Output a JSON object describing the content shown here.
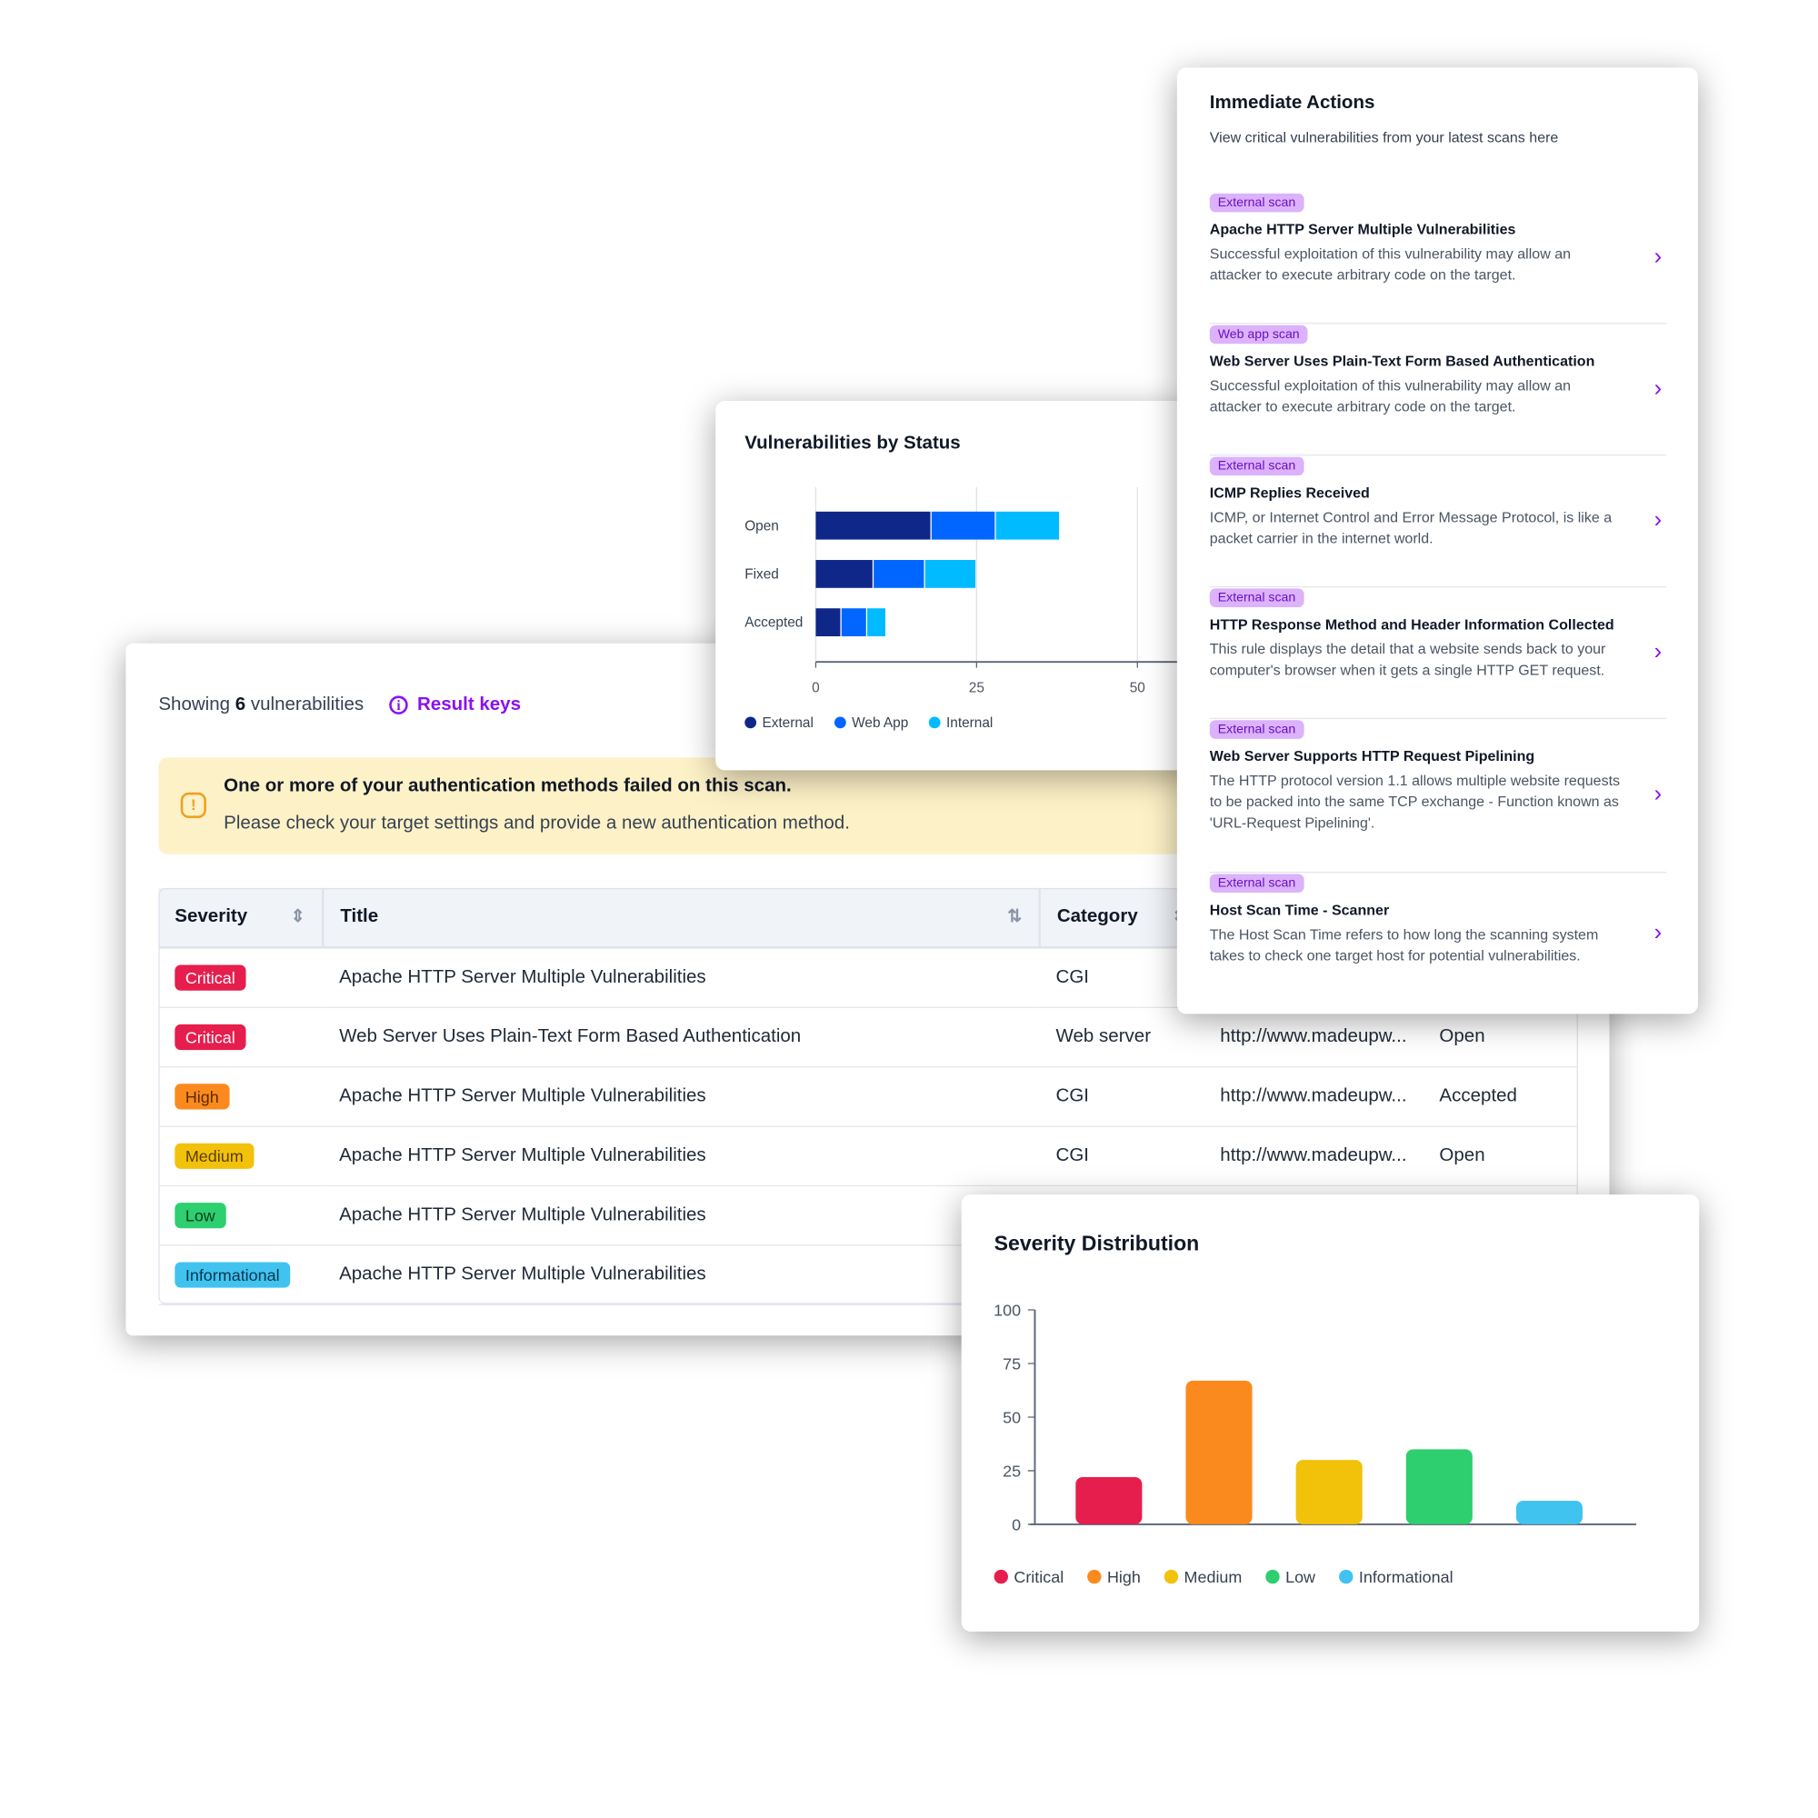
{
  "main": {
    "showing_prefix": "Showing",
    "showing_count": "6",
    "showing_suffix": "vulnerabilities",
    "result_keys": "Result keys",
    "warning": {
      "title": "One or more of your authentication methods failed on this scan.",
      "body": "Please check your target settings and provide a new authentication method."
    },
    "table": {
      "columns": [
        "Severity",
        "Title",
        "Category"
      ],
      "rows": [
        {
          "severity": "Critical",
          "title": "Apache HTTP Server Multiple Vulnerabilities",
          "category": "CGI",
          "url": "",
          "status": ""
        },
        {
          "severity": "Critical",
          "title": "Web Server Uses Plain-Text Form Based Authentication",
          "category": "Web server",
          "url": "http://www.madeupw...",
          "status": "Open"
        },
        {
          "severity": "High",
          "title": "Apache HTTP Server Multiple Vulnerabilities",
          "category": "CGI",
          "url": "http://www.madeupw...",
          "status": "Accepted"
        },
        {
          "severity": "Medium",
          "title": "Apache HTTP Server Multiple Vulnerabilities",
          "category": "CGI",
          "url": "http://www.madeupw...",
          "status": "Open"
        },
        {
          "severity": "Low",
          "title": "Apache HTTP Server Multiple Vulnerabilities",
          "category": "",
          "url": "",
          "status": ""
        },
        {
          "severity": "Informational",
          "title": "Apache HTTP Server Multiple Vulnerabilities",
          "category": "",
          "url": "",
          "status": ""
        }
      ]
    },
    "severity_colors": {
      "Critical": {
        "bg": "#e61e4d",
        "fg": "#ffffff"
      },
      "High": {
        "bg": "#fb8a1e",
        "fg": "#5a2a00"
      },
      "Medium": {
        "bg": "#f2c10a",
        "fg": "#5a3e00"
      },
      "Low": {
        "bg": "#2dcf6f",
        "fg": "#0b3d1d"
      },
      "Informational": {
        "bg": "#41c3f0",
        "fg": "#0b3550"
      }
    }
  },
  "immediate_actions": {
    "title": "Immediate Actions",
    "subtitle": "View critical vulnerabilities from your latest scans here",
    "items": [
      {
        "tag": "External scan",
        "title": "Apache HTTP Server Multiple Vulnerabilities",
        "desc": "Successful exploitation of this vulnerability may allow an attacker to execute arbitrary code on the target."
      },
      {
        "tag": "Web app scan",
        "title": "Web Server Uses Plain-Text Form Based Authentication",
        "desc": "Successful exploitation of this vulnerability may allow an attacker to execute arbitrary code on the target."
      },
      {
        "tag": "External scan",
        "title": "ICMP Replies Received",
        "desc": "ICMP, or Internet Control and Error Message Protocol, is like a packet carrier in the internet world."
      },
      {
        "tag": "External scan",
        "title": "HTTP Response Method and Header Information Collected",
        "desc": "This rule displays the detail that a website sends back to your computer's browser when it gets a single HTTP GET request."
      },
      {
        "tag": "External scan",
        "title": "Web Server Supports HTTP Request Pipelining",
        "desc": "The HTTP protocol version 1.1 allows multiple website requests to be packed into the same TCP exchange - Function known as 'URL-Request Pipelining'."
      },
      {
        "tag": "External scan",
        "title": "Host Scan Time - Scanner",
        "desc": "The Host Scan Time refers to how long the scanning system takes to check one target host for potential vulnerabilities."
      }
    ]
  },
  "chart_data": [
    {
      "type": "bar",
      "orientation": "horizontal",
      "stacked": true,
      "title": "Vulnerabilities by Status",
      "categories": [
        "Open",
        "Fixed",
        "Accepted"
      ],
      "series": [
        {
          "name": "External",
          "values": [
            18,
            9,
            4
          ],
          "color": "#0f2788"
        },
        {
          "name": "Web App",
          "values": [
            10,
            8,
            4
          ],
          "color": "#0066ff"
        },
        {
          "name": "Internal",
          "values": [
            10,
            8,
            3
          ],
          "color": "#00bbff"
        }
      ],
      "xticks": [
        "0",
        "25",
        "50"
      ],
      "xlim": [
        0,
        50
      ],
      "grid": true,
      "legend": "bottom-left"
    },
    {
      "type": "bar",
      "title": "Severity Distribution",
      "categories": [
        "Critical",
        "High",
        "Medium",
        "Low",
        "Informational"
      ],
      "values": [
        22,
        67,
        30,
        35,
        11
      ],
      "colors": [
        "#e61e4d",
        "#fb8a1e",
        "#f2c10a",
        "#2dcf6f",
        "#41c3f0"
      ],
      "yticks": [
        "0",
        "25",
        "50",
        "75",
        "100"
      ],
      "ylim": [
        0,
        100
      ],
      "grid": false,
      "legend": "bottom-left"
    }
  ]
}
